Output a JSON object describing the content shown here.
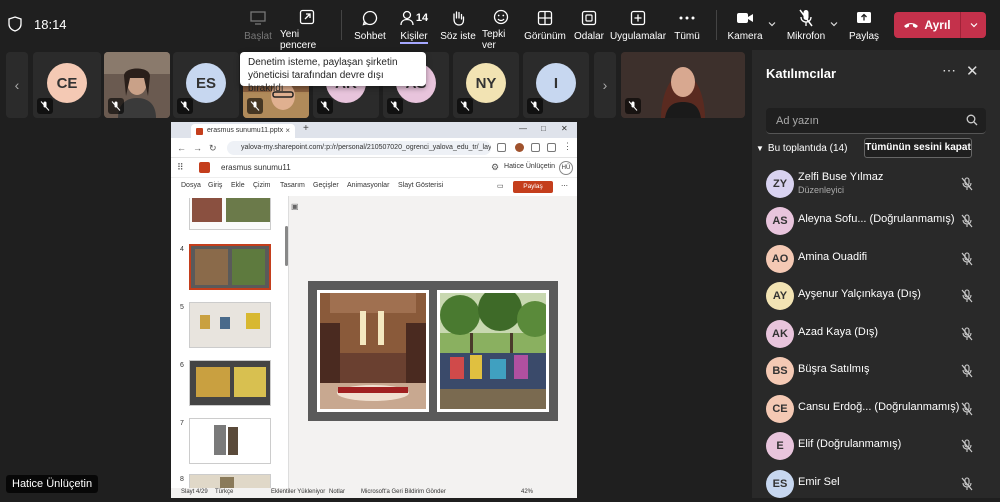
{
  "header": {
    "time": "18:14",
    "buttons": [
      {
        "label": "Başlat",
        "icon": "share-screen-icon",
        "disabled": true
      },
      {
        "label": "Yeni pencere",
        "icon": "new-window-icon"
      },
      {
        "label": "Sohbet",
        "icon": "chat-icon"
      },
      {
        "label": "Kişiler",
        "icon": "people-icon",
        "active": true
      },
      {
        "label": "Söz iste",
        "icon": "raise-hand-icon"
      },
      {
        "label": "Tepki ver",
        "icon": "react-icon"
      },
      {
        "label": "Görünüm",
        "icon": "view-icon"
      },
      {
        "label": "Odalar",
        "icon": "rooms-icon"
      },
      {
        "label": "Uygulamalar",
        "icon": "apps-icon"
      },
      {
        "label": "Tümü",
        "icon": "more-icon"
      },
      {
        "label": "Kamera",
        "icon": "camera-icon"
      },
      {
        "label": "Mikrofon",
        "icon": "mic-off-icon"
      },
      {
        "label": "Paylaş",
        "icon": "share-icon"
      }
    ],
    "people_count": "14",
    "leave_label": "Ayrıl",
    "leave_color": "#c4314b"
  },
  "tooltip": "Denetim isteme, paylaşan şirketin yöneticisi tarafından devre dışı bırakıldı",
  "strip": {
    "tiles": [
      {
        "initials": "CE",
        "color": "#f4c9b4"
      },
      {
        "initials": "",
        "video": true
      },
      {
        "initials": "ES",
        "color": "#c7d7f0"
      },
      {
        "initials": "",
        "video": true
      },
      {
        "initials": "AK",
        "color": "#e8c4dc"
      },
      {
        "initials": "AS",
        "color": "#e8c4dc"
      },
      {
        "initials": "NY",
        "color": "#f2e3b3"
      },
      {
        "initials": "I",
        "color": "#c7d7f0"
      }
    ]
  },
  "presenter_name": "Hatice Ünlüçetin",
  "browser": {
    "tab_title": "erasmus sunumu11.pptx",
    "url": "yalova-my.sharepoint.com/:p:/r/personal/210507020_ogrenci_yalova_edu_tr/_layout...",
    "app_name": "erasmus sunumu11",
    "user_name": "Hatice Ünlüçetin",
    "user_initials": "HÜ",
    "ribbon": [
      "Dosya",
      "Giriş",
      "Ekle",
      "Çizim",
      "Tasarım",
      "Geçişler",
      "Animasyonlar",
      "Slayt Gösterisi"
    ],
    "share_label": "Paylaş",
    "thumb_numbers": [
      "4",
      "5",
      "6",
      "7",
      "8"
    ],
    "status_slide": "Slayt 4/29",
    "status_lang": "Türkçe",
    "status_addins": "Eklentiler Yükleniyor",
    "status_notes": "Notlar",
    "status_feedback": "Microsoft'a Geri Bildirim Gönder",
    "status_zoom": "42%"
  },
  "panel": {
    "title": "Katılımcılar",
    "search_placeholder": "Ad yazın",
    "in_meeting": "Bu toplantıda (14)",
    "mute_all": "Tümünün sesini kapat",
    "participants": [
      {
        "initials": "ZY",
        "name": "Zelfi Buse Yılmaz",
        "role": "Düzenleyici",
        "color": "#d8d2f0"
      },
      {
        "initials": "AS",
        "name": "Aleyna Sofu... (Doğrulanmamış)",
        "color": "#e8c4dc"
      },
      {
        "initials": "AO",
        "name": "Amina Ouadifi",
        "color": "#f4c9b4"
      },
      {
        "initials": "AY",
        "name": "Ayşenur Yalçınkaya (Dış)",
        "color": "#f2e3b3"
      },
      {
        "initials": "AK",
        "name": "Azad Kaya (Dış)",
        "color": "#e8c4dc"
      },
      {
        "initials": "BS",
        "name": "Büşra Satılmış",
        "color": "#f4c9b4"
      },
      {
        "initials": "CE",
        "name": "Cansu Erdoğ... (Doğrulanmamış)",
        "color": "#f4c9b4"
      },
      {
        "initials": "E",
        "name": "Elif (Doğrulanmamış)",
        "color": "#e8c4dc"
      },
      {
        "initials": "ES",
        "name": "Emir Sel",
        "color": "#c7d7f0"
      }
    ]
  }
}
